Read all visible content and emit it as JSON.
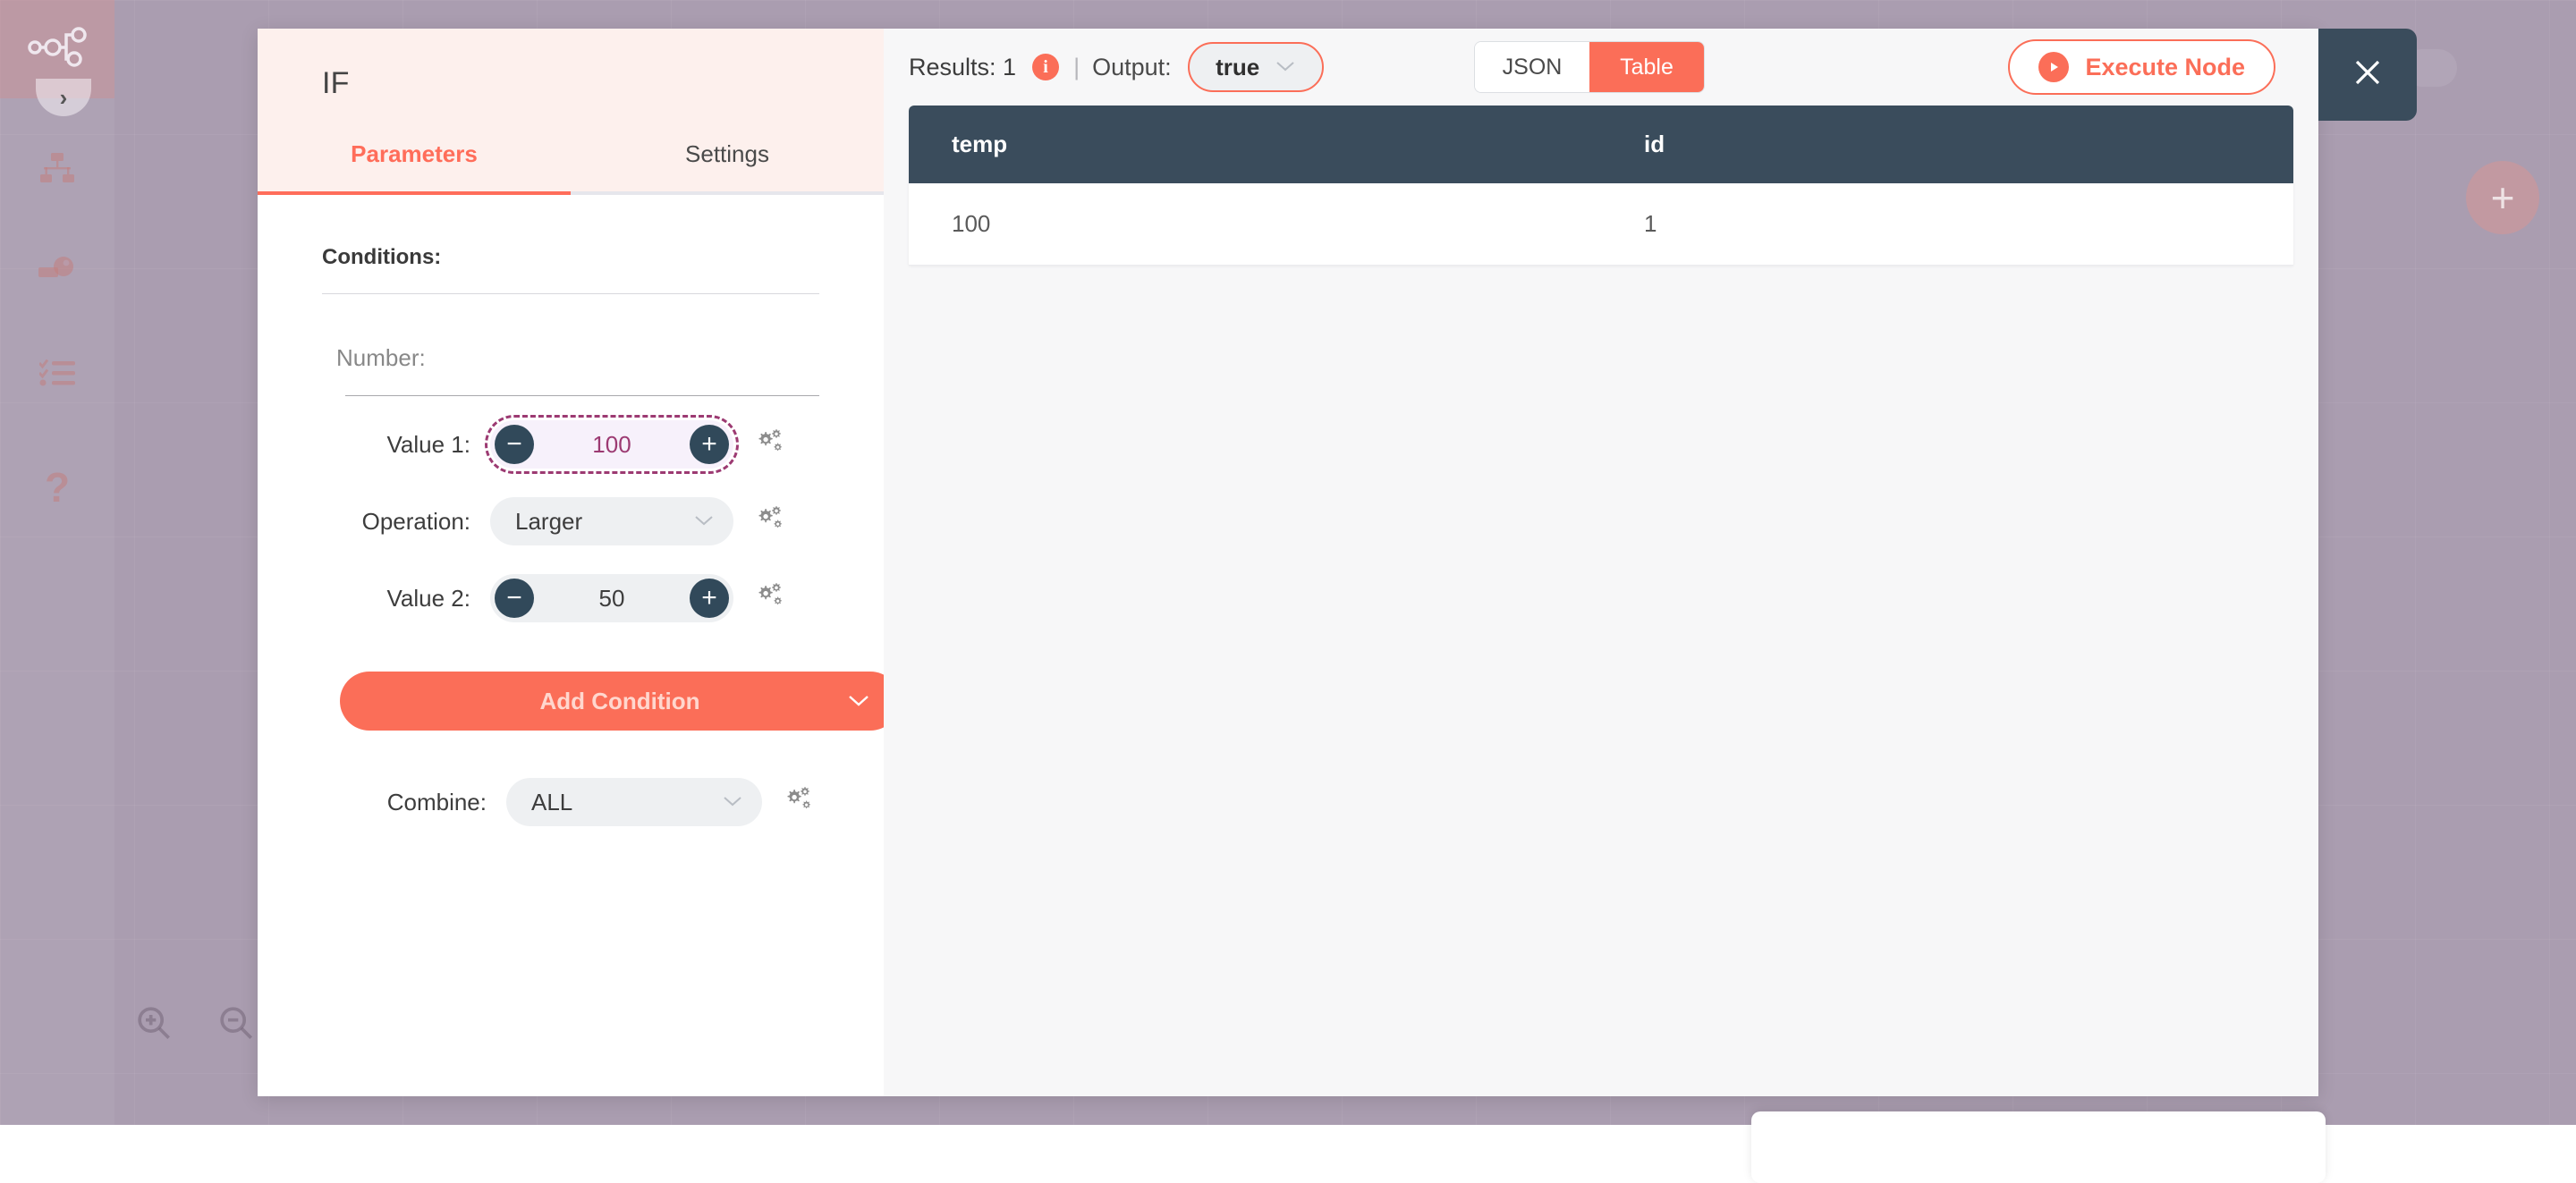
{
  "sidebar": {
    "items": [
      {
        "name": "workflow-logo",
        "icon": "workflow-nodes-logo"
      },
      {
        "name": "expand",
        "icon": "chevron-right-icon"
      },
      {
        "name": "workflows",
        "icon": "sitemap-icon"
      },
      {
        "name": "credentials",
        "icon": "key-icon"
      },
      {
        "name": "executions",
        "icon": "checklist-icon"
      },
      {
        "name": "help",
        "icon": "question-mark-icon"
      }
    ]
  },
  "canvas": {
    "zoom_in_icon": "zoom-in-icon",
    "zoom_out_icon": "zoom-out-icon",
    "add_node_icon": "plus-icon"
  },
  "ndv": {
    "node_title": "IF",
    "tabs": [
      {
        "label": "Parameters",
        "active": true
      },
      {
        "label": "Settings",
        "active": false
      }
    ],
    "parameters": {
      "conditions_label": "Conditions:",
      "group_label": "Number:",
      "rows": [
        {
          "label": "Value 1:",
          "control": "stepper",
          "value": "100",
          "minus": "−",
          "plus": "+",
          "highlighted": true,
          "gear_icon": "gears-options-icon"
        },
        {
          "label": "Operation:",
          "control": "select",
          "value": "Larger",
          "caret": "⌄",
          "gear_icon": "gears-options-icon"
        },
        {
          "label": "Value 2:",
          "control": "stepper",
          "value": "50",
          "minus": "−",
          "plus": "+",
          "highlighted": false,
          "gear_icon": "gears-options-icon"
        }
      ],
      "add_condition_label": "Add Condition",
      "add_condition_caret": "⌄",
      "combine": {
        "label": "Combine:",
        "value": "ALL",
        "caret": "⌄",
        "gear_icon": "gears-options-icon"
      }
    },
    "results": {
      "results_label": "Results: 1",
      "info_badge": "i",
      "separator": "|",
      "output_label": "Output:",
      "output_value": "true",
      "output_caret": "⌄",
      "view_toggle": [
        {
          "label": "JSON",
          "active": false
        },
        {
          "label": "Table",
          "active": true
        }
      ],
      "execute_label": "Execute Node",
      "execute_icon": "play-circle-icon",
      "table": {
        "columns": [
          "temp",
          "id"
        ],
        "rows": [
          [
            "100",
            "1"
          ]
        ]
      }
    },
    "close_icon": "close-x-icon"
  },
  "colors": {
    "accent": "#fb6e58",
    "dark": "#3a4c5c",
    "canvas": "#aa9db0",
    "header_tint": "#fdf0ed",
    "highlight_outline": "#9c3a72"
  }
}
